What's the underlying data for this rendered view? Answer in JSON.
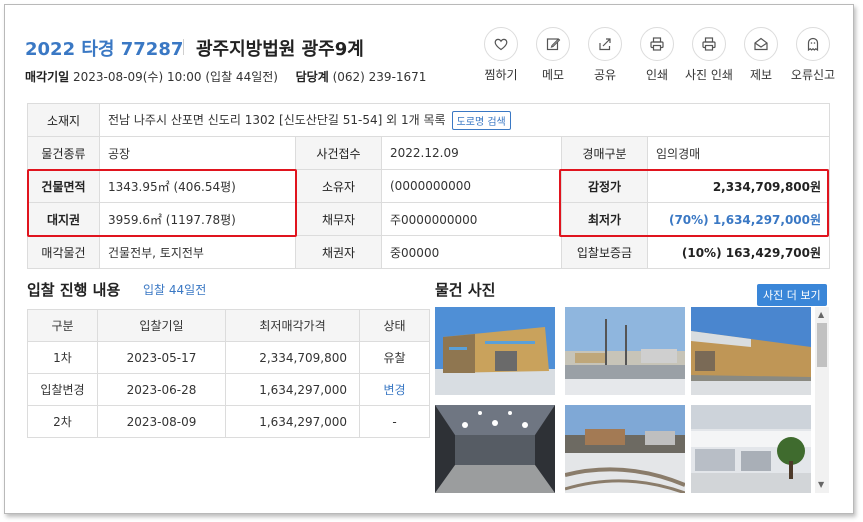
{
  "header": {
    "case_no": "2022 타경 77287",
    "court": "광주지방법원 광주9계",
    "sale_label": "매각기일",
    "sale_value": "2023-08-09(수) 10:00 (입찰 44일전)",
    "manager_label": "담당계",
    "manager_phone": "(062) 239-1671"
  },
  "actions": [
    {
      "label": "찜하기",
      "icon": "heart-icon"
    },
    {
      "label": "메모",
      "icon": "memo-icon"
    },
    {
      "label": "공유",
      "icon": "share-icon"
    },
    {
      "label": "인쇄",
      "icon": "print-icon"
    },
    {
      "label": "사진 인쇄",
      "icon": "photo-print-icon"
    },
    {
      "label": "제보",
      "icon": "report-mail-icon"
    },
    {
      "label": "오류신고",
      "icon": "error-report-icon"
    }
  ],
  "info": {
    "location_label": "소재지",
    "location_value": "전남 나주시 산포면 신도리 1302 [신도산단길 51-54] 외 1개 목록",
    "road_btn": "도로명 검색",
    "type_label": "물건종류",
    "type_value": "공장",
    "received_label": "사건접수",
    "received_value": "2022.12.09",
    "auction_kind_label": "경매구분",
    "auction_kind_value": "임의경매",
    "building_area_label": "건물면적",
    "building_area_value": "1343.95㎡ (406.54평)",
    "owner_label": "소유자",
    "owner_value": "(0000000000",
    "appraisal_label": "감정가",
    "appraisal_value": "2,334,709,800원",
    "land_label": "대지권",
    "land_value": "3959.6㎡ (1197.78평)",
    "debtor_label": "채무자",
    "debtor_value": "주0000000000",
    "min_label": "최저가",
    "min_value": "(70%) 1,634,297,000원",
    "sale_items_label": "매각물건",
    "sale_items_value": "건물전부, 토지전부",
    "creditor_label": "채권자",
    "creditor_value": "중00000",
    "deposit_label": "입찰보증금",
    "deposit_value": "(10%) 163,429,700원"
  },
  "bids": {
    "title": "입찰 진행 내용",
    "subtitle": "입찰 44일전",
    "headers": [
      "구분",
      "입찰기일",
      "최저매각가격",
      "상태"
    ],
    "rows": [
      [
        "1차",
        "2023-05-17",
        "2,334,709,800",
        "유찰"
      ],
      [
        "입찰변경",
        "2023-06-28",
        "1,634,297,000",
        "변경"
      ],
      [
        "2차",
        "2023-08-09",
        "1,634,297,000",
        "-"
      ]
    ]
  },
  "photos": {
    "title": "물건 사진",
    "more_btn": "사진 더 보기"
  },
  "colors": {
    "accent": "#3a78c4",
    "highlight": "#e0141e",
    "header_cell": "#f5f5f5"
  }
}
